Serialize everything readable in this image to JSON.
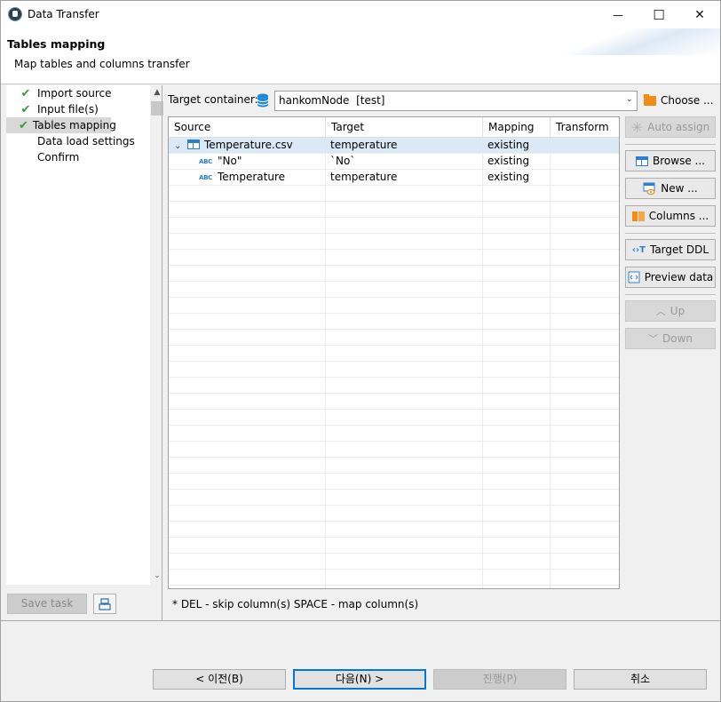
{
  "window": {
    "title": "Data Transfer",
    "controls": {
      "minimize": "—",
      "maximize": "☐",
      "close": "✕"
    }
  },
  "header": {
    "title": "Tables mapping",
    "description": "Map tables and columns transfer"
  },
  "steps": [
    {
      "label": "Import source",
      "done": true
    },
    {
      "label": "Input file(s)",
      "done": true
    },
    {
      "label": "Tables mapping",
      "done": true,
      "selected": true
    },
    {
      "label": "Data load settings",
      "done": false
    },
    {
      "label": "Confirm",
      "done": false
    }
  ],
  "left_footer": {
    "save_task": "Save task"
  },
  "target_container": {
    "label": "Target container:",
    "value": "hankomNode  [test]",
    "choose": "Choose ..."
  },
  "table": {
    "columns": [
      "Source",
      "Target",
      "Mapping",
      "Transform"
    ],
    "rows": [
      {
        "source": "Temperature.csv",
        "target": "temperature",
        "mapping": "existing",
        "transform": "",
        "kind": "table"
      },
      {
        "source": "\"No\"",
        "target": "`No`",
        "mapping": "existing",
        "transform": "",
        "kind": "column"
      },
      {
        "source": "Temperature",
        "target": "temperature",
        "mapping": "existing",
        "transform": "",
        "kind": "column"
      }
    ]
  },
  "hint": "* DEL - skip column(s)  SPACE - map column(s)",
  "side_buttons": {
    "auto_assign": "Auto assign",
    "browse": "Browse ...",
    "new": "New ...",
    "columns": "Columns ...",
    "target_ddl": "Target DDL",
    "preview_data": "Preview data",
    "up": "Up",
    "down": "Down"
  },
  "nav": {
    "back": "< 이전(B)",
    "next": "다음(N) >",
    "finish": "진행(P)",
    "cancel": "취소"
  }
}
